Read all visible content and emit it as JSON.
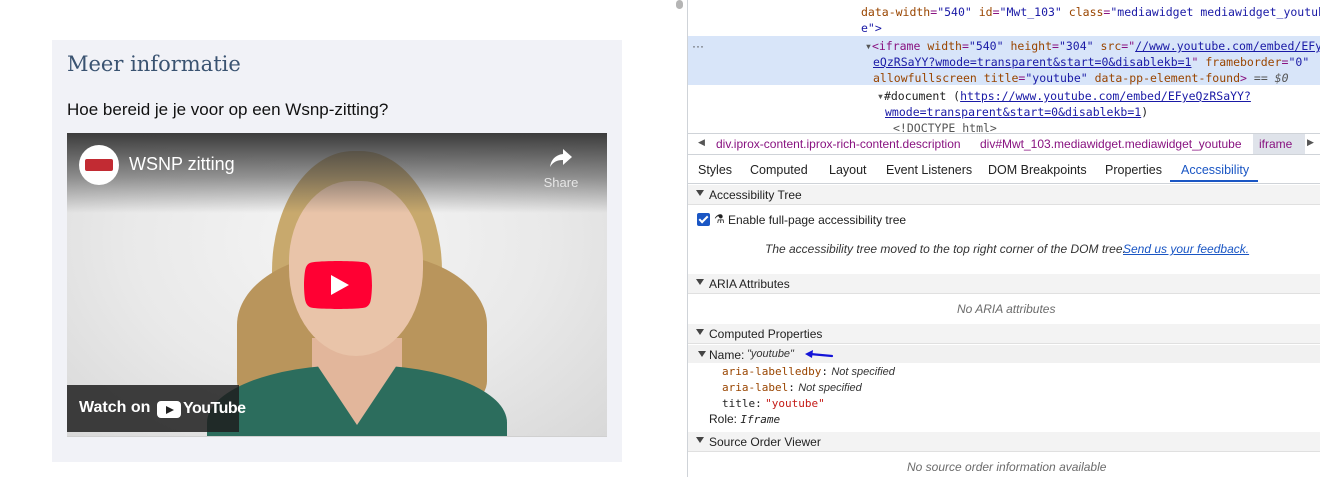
{
  "page": {
    "box_title": "Meer informatie",
    "question": "Hoe bereid je je voor op een Wsnp-zitting?",
    "video": {
      "title": "WSNP zitting",
      "share_label": "Share",
      "watch_on_label": "Watch on",
      "youtube_logo_text": "YouTube"
    }
  },
  "devtools": {
    "dom": {
      "line1": {
        "attr_name": "data-width",
        "attr_value": "\"540\"",
        "id_name": "id",
        "id_value": "\"Mwt_103\"",
        "class_name": "class",
        "class_value": "\"mediawidget mediawidget_youtub"
      },
      "line2": "e\">",
      "sel_dots": "···",
      "iframe": {
        "tag_open": "<iframe",
        "width_name": "width",
        "width_value": "\"540\"",
        "height_name": "height",
        "height_value": "\"304\"",
        "src_name": "src",
        "src_value_1": "//www.youtube.com/embed/EFy",
        "src_value_2": "eQzRSaYY?wmode=transparent&start=0&disablekb=1",
        "frameborder_name": "frameborder",
        "frameborder_value": "\"0\"",
        "allowfullscreen": "allowfullscreen",
        "title_name": "title",
        "title_value": "\"youtube\"",
        "data_pp": "data-pp-element-found",
        "tag_close": ">",
        "eq_dollar": "== $0"
      },
      "document_label": "#document (",
      "document_url_1": "https://www.youtube.com/embed/EFyeQzRSaYY?",
      "document_url_2": "wmode=transparent&start=0&disablekb=1",
      "document_close": ")",
      "doctype": "<!DOCTYPE html>"
    },
    "breadcrumb": [
      "div.iprox-content.iprox-rich-content.description",
      "div#Mwt_103.mediawidget.mediawidget_youtube",
      "iframe"
    ],
    "tabs": [
      "Styles",
      "Computed",
      "Layout",
      "Event Listeners",
      "DOM Breakpoints",
      "Properties",
      "Accessibility"
    ],
    "active_tab": "Accessibility",
    "accessibility_tree": {
      "header": "Accessibility Tree",
      "checkbox_label": "Enable full-page accessibility tree",
      "checked": true,
      "moved_note": "The accessibility tree moved to the top right corner of the DOM tree.",
      "feedback_link": "Send us your feedback."
    },
    "aria_attributes": {
      "header": "ARIA Attributes",
      "empty": "No ARIA attributes"
    },
    "computed_properties": {
      "header": "Computed Properties",
      "name_label": "Name:",
      "name_value": "\"youtube\"",
      "labelledby_key": "aria-labelledby",
      "labelledby_value": "Not specified",
      "label_key": "aria-label",
      "label_value": "Not specified",
      "title_key": "title",
      "title_value": "\"youtube\"",
      "role_label": "Role:",
      "role_value": "Iframe"
    },
    "source_order": {
      "header": "Source Order Viewer",
      "empty": "No source order information available"
    },
    "colors": {
      "accent": "#1a56c4",
      "tag": "#881280",
      "attr": "#994500",
      "value": "#1a1aa6",
      "selected_row": "#d8e5f9"
    }
  }
}
